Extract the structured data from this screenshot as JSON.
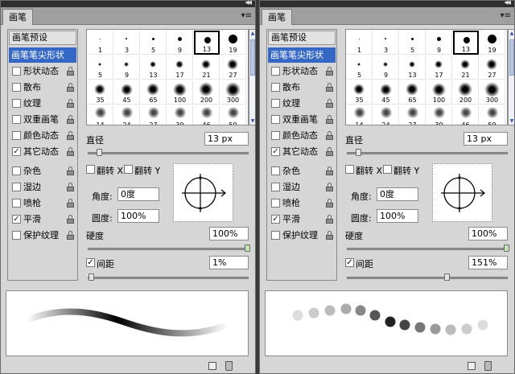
{
  "panels": [
    {
      "tab_label": "画笔",
      "preset_button": "画笔预设",
      "options": [
        {
          "label": "画笔笔尖形状",
          "checkbox": false,
          "checked": false,
          "locked": false,
          "selected": true
        },
        {
          "label": "形状动态",
          "checkbox": true,
          "checked": false,
          "locked": true,
          "selected": false
        },
        {
          "label": "散布",
          "checkbox": true,
          "checked": false,
          "locked": true,
          "selected": false
        },
        {
          "label": "纹理",
          "checkbox": true,
          "checked": false,
          "locked": true,
          "selected": false
        },
        {
          "label": "双重画笔",
          "checkbox": true,
          "checked": false,
          "locked": true,
          "selected": false
        },
        {
          "label": "颜色动态",
          "checkbox": true,
          "checked": false,
          "locked": true,
          "selected": false
        },
        {
          "label": "其它动态",
          "checkbox": true,
          "checked": true,
          "locked": true,
          "selected": false
        },
        {
          "label": "杂色",
          "checkbox": true,
          "checked": false,
          "locked": true,
          "selected": false
        },
        {
          "label": "湿边",
          "checkbox": true,
          "checked": false,
          "locked": true,
          "selected": false
        },
        {
          "label": "喷枪",
          "checkbox": true,
          "checked": false,
          "locked": true,
          "selected": false
        },
        {
          "label": "平滑",
          "checkbox": true,
          "checked": true,
          "locked": true,
          "selected": false
        },
        {
          "label": "保护纹理",
          "checkbox": true,
          "checked": false,
          "locked": true,
          "selected": false
        }
      ],
      "brush_sizes": [
        "1",
        "3",
        "5",
        "9",
        "13",
        "19",
        "5",
        "9",
        "13",
        "17",
        "21",
        "27",
        "35",
        "45",
        "65",
        "100",
        "200",
        "300",
        "14",
        "24",
        "27",
        "39",
        "46",
        "59"
      ],
      "selected_brush": "13",
      "diameter_label": "直径",
      "diameter_value": "13 px",
      "diameter_slider": 0.05,
      "flip_x_label": "翻转 X",
      "flip_y_label": "翻转 Y",
      "angle_label": "角度:",
      "angle_value": "0度",
      "roundness_label": "圆度:",
      "roundness_value": "100%",
      "hardness_label": "硬度",
      "hardness_value": "100%",
      "hardness_slider": 1.0,
      "spacing_label": "间距",
      "spacing_checked": true,
      "spacing_value": "1%",
      "spacing_slider": 0.0
    },
    {
      "tab_label": "画笔",
      "preset_button": "画笔预设",
      "options": [
        {
          "label": "画笔笔尖形状",
          "checkbox": false,
          "checked": false,
          "locked": false,
          "selected": true
        },
        {
          "label": "形状动态",
          "checkbox": true,
          "checked": false,
          "locked": true,
          "selected": false
        },
        {
          "label": "散布",
          "checkbox": true,
          "checked": false,
          "locked": true,
          "selected": false
        },
        {
          "label": "纹理",
          "checkbox": true,
          "checked": false,
          "locked": true,
          "selected": false
        },
        {
          "label": "双重画笔",
          "checkbox": true,
          "checked": false,
          "locked": true,
          "selected": false
        },
        {
          "label": "颜色动态",
          "checkbox": true,
          "checked": false,
          "locked": true,
          "selected": false
        },
        {
          "label": "其它动态",
          "checkbox": true,
          "checked": true,
          "locked": true,
          "selected": false
        },
        {
          "label": "杂色",
          "checkbox": true,
          "checked": false,
          "locked": true,
          "selected": false
        },
        {
          "label": "湿边",
          "checkbox": true,
          "checked": false,
          "locked": true,
          "selected": false
        },
        {
          "label": "喷枪",
          "checkbox": true,
          "checked": false,
          "locked": true,
          "selected": false
        },
        {
          "label": "平滑",
          "checkbox": true,
          "checked": true,
          "locked": true,
          "selected": false
        },
        {
          "label": "保护纹理",
          "checkbox": true,
          "checked": false,
          "locked": true,
          "selected": false
        }
      ],
      "brush_sizes": [
        "1",
        "3",
        "5",
        "9",
        "13",
        "19",
        "5",
        "9",
        "13",
        "17",
        "21",
        "27",
        "35",
        "45",
        "65",
        "100",
        "200",
        "300",
        "14",
        "24",
        "27",
        "39",
        "46",
        "59"
      ],
      "selected_brush": "13",
      "diameter_label": "直径",
      "diameter_value": "13 px",
      "diameter_slider": 0.05,
      "flip_x_label": "翻转 X",
      "flip_y_label": "翻转 Y",
      "angle_label": "角度:",
      "angle_value": "0度",
      "roundness_label": "圆度:",
      "roundness_value": "100%",
      "hardness_label": "硬度",
      "hardness_value": "100%",
      "hardness_slider": 1.0,
      "spacing_label": "间距",
      "spacing_checked": true,
      "spacing_value": "151%",
      "spacing_slider": 0.62
    }
  ]
}
